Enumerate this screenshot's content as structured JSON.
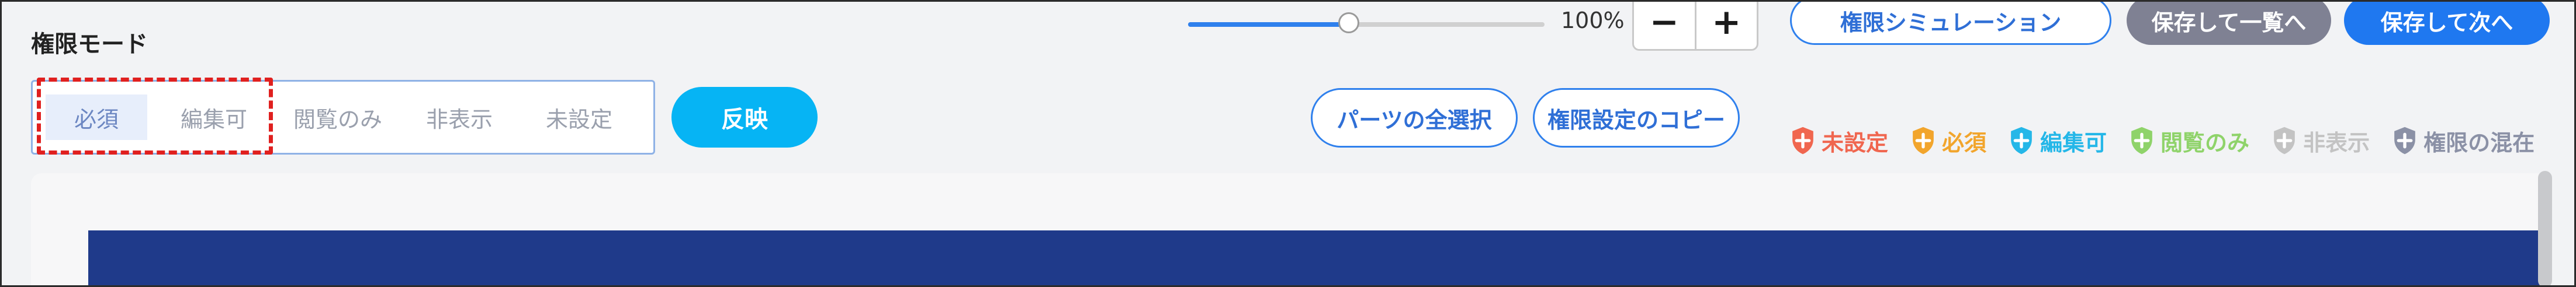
{
  "header": {
    "title": "権限モード"
  },
  "zoom": {
    "value_text": "100%",
    "level": 0.45,
    "minus": "−",
    "plus": "+"
  },
  "actions": {
    "simulation": "権限シミュレーション",
    "save_list": "保存して一覧へ",
    "save_next": "保存して次へ"
  },
  "modes": {
    "options": [
      "必須",
      "編集可",
      "閲覧のみ",
      "非表示",
      "未設定"
    ],
    "selected": "必須",
    "apply": "反映"
  },
  "tools": {
    "select_all": "パーツの全選択",
    "copy": "権限設定のコピー"
  },
  "legend": [
    {
      "label": "未設定",
      "color": "#f0664f",
      "icon": "shield-plus-icon"
    },
    {
      "label": "必須",
      "color": "#f2a52c",
      "icon": "shield-plus-icon"
    },
    {
      "label": "編集可",
      "color": "#25b7e8",
      "icon": "shield-plus-icon"
    },
    {
      "label": "閲覧のみ",
      "color": "#8fd36a",
      "icon": "shield-plus-icon"
    },
    {
      "label": "非表示",
      "color": "#c3c3c3",
      "icon": "shield-plus-icon"
    },
    {
      "label": "権限の混在",
      "color": "#8b91a6",
      "icon": "shield-plus-icon"
    }
  ],
  "colors": {
    "accent": "#2f80ed",
    "apply": "#06b4f4",
    "highlight": "#e0201f",
    "banner": "#1f3a8a"
  }
}
